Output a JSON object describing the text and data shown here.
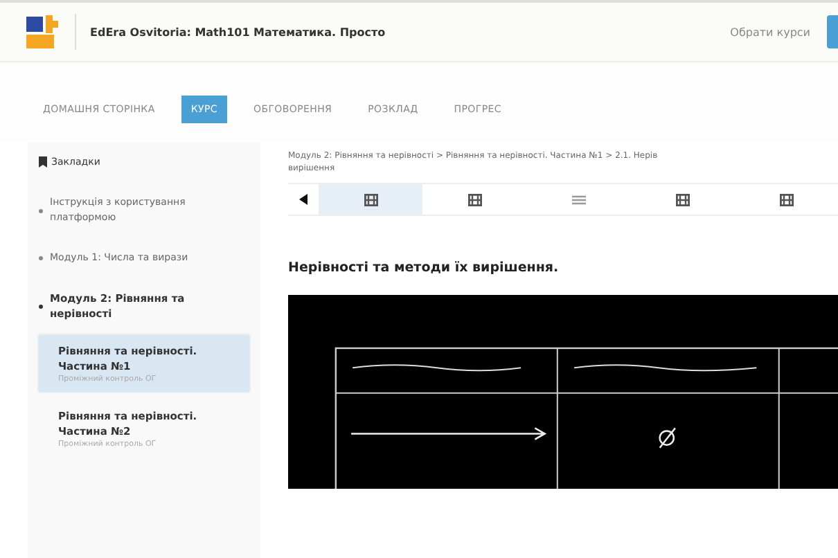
{
  "header": {
    "course_title": "EdEra Osvitoria: Math101 Математика. Просто",
    "choose_courses": "Обрати курси"
  },
  "tabs": [
    {
      "label": "ДОМАШНЯ СТОРІНКА",
      "selected": false
    },
    {
      "label": "КУРС",
      "selected": true
    },
    {
      "label": "ОБГОВОРЕННЯ",
      "selected": false
    },
    {
      "label": "РОЗКЛАД",
      "selected": false
    },
    {
      "label": "ПРОГРЕС",
      "selected": false
    }
  ],
  "sidebar": {
    "bookmarks": "Закладки",
    "items": [
      {
        "label": "Інструкція з користування платформою",
        "expanded": false
      },
      {
        "label": "Модуль 1: Числа та вирази",
        "expanded": false
      },
      {
        "label": "Модуль 2: Рівняння та нерівності",
        "expanded": true,
        "children": [
          {
            "label": "Рівняння та нерівності. Частина №1",
            "subtitle": "Проміжний контроль ОГ",
            "selected": true
          },
          {
            "label": "Рівняння та нерівності. Частина №2",
            "subtitle": "Проміжний контроль ОГ",
            "selected": false
          }
        ]
      }
    ]
  },
  "breadcrumb": [
    "Модуль 2: Рівняння та нерівності > Рівняння та нерівності. Частина №1 > 2.1. Нерів",
    "вирішення"
  ],
  "units": [
    {
      "kind": "video",
      "selected": true
    },
    {
      "kind": "video",
      "selected": false
    },
    {
      "kind": "text",
      "selected": false
    },
    {
      "kind": "video",
      "selected": false
    },
    {
      "kind": "video",
      "selected": false
    }
  ],
  "heading": "Нерівності та методи їх вирішення.",
  "video": {
    "kind": "picture"
  }
}
